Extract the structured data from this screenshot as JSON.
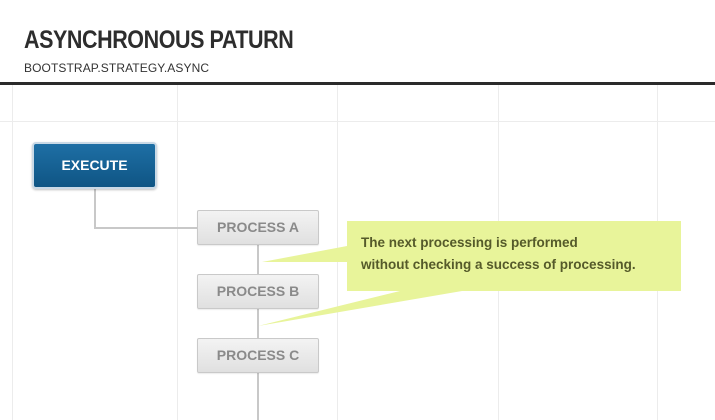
{
  "header": {
    "title": "ASYNCHRONOUS PATURN",
    "subtitle": "BOOTSTRAP.STRATEGY.ASYNC"
  },
  "diagram": {
    "execute_label": "EXECUTE",
    "processes": [
      {
        "label": "PROCESS A"
      },
      {
        "label": "PROCESS B"
      },
      {
        "label": "PROCESS C"
      }
    ],
    "note": {
      "line1": "The next processing is performed",
      "line2": "without checking a success of processing."
    }
  },
  "colors": {
    "execute_fill": "#13608f",
    "process_fill": "#e8e8e8",
    "note_fill": "#e8f49a",
    "connector": "#c8c8c8",
    "grid": "#ececec"
  }
}
